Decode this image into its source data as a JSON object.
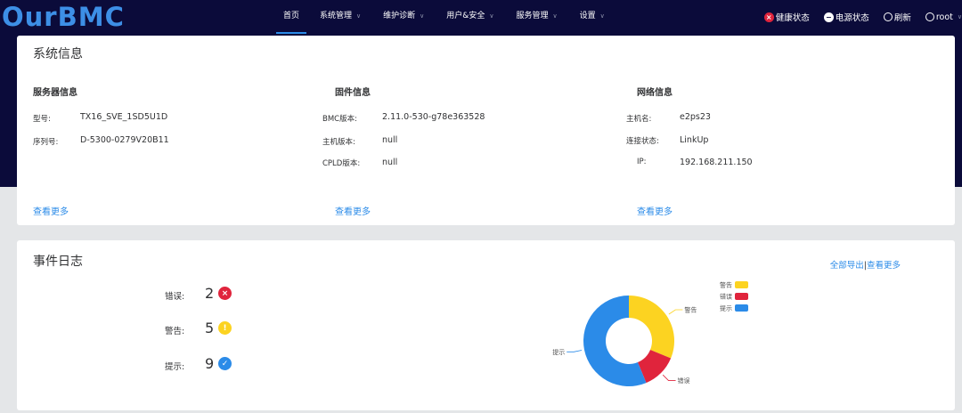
{
  "nav": {
    "logo": "OurBMC",
    "menu": [
      {
        "label": "首页",
        "has_caret": false
      },
      {
        "label": "系统管理",
        "has_caret": true
      },
      {
        "label": "维护诊断",
        "has_caret": true
      },
      {
        "label": "用户&安全",
        "has_caret": true
      },
      {
        "label": "服务管理",
        "has_caret": true
      },
      {
        "label": "设置",
        "has_caret": true
      }
    ],
    "right": {
      "health": "健康状态",
      "power": "电源状态",
      "refresh": "刷新",
      "user": "root"
    }
  },
  "system_info": {
    "title": "系统信息",
    "server": {
      "title": "服务器信息",
      "model_label": "型号:",
      "model": "TX16_SVE_1SD5U1D",
      "serial_label": "序列号:",
      "serial": "D-5300-0279V20B11",
      "more": "查看更多"
    },
    "firmware": {
      "title": "固件信息",
      "bmc_label": "BMC版本:",
      "bmc": "2.11.0-530-g78e363528",
      "host_label": "主机版本:",
      "host": "null",
      "cpld_label": "CPLD版本:",
      "cpld": "null",
      "more": "查看更多"
    },
    "network": {
      "title": "网络信息",
      "hostname_label": "主机名:",
      "hostname": "e2ps23",
      "link_label": "连接状态:",
      "link": "LinkUp",
      "ip_label": "IP:",
      "ip": "192.168.211.150",
      "more": "查看更多"
    }
  },
  "event_log": {
    "title": "事件日志",
    "export_all": "全部导出",
    "separator": "|",
    "view_more": "查看更多",
    "error_label": "错误:",
    "error_count": "2",
    "warning_label": "警告:",
    "warning_count": "5",
    "info_label": "提示:",
    "info_count": "9"
  },
  "chart_data": {
    "type": "pie",
    "donut": true,
    "categories": [
      "警告",
      "错误",
      "提示"
    ],
    "values": [
      5,
      2,
      9
    ],
    "colors": [
      "#fcd321",
      "#e0243c",
      "#2b8be8"
    ],
    "legend": [
      "警告",
      "错误",
      "提示"
    ],
    "legend_position": "top-right",
    "slice_labels": [
      "警告",
      "错误",
      "提示"
    ]
  }
}
